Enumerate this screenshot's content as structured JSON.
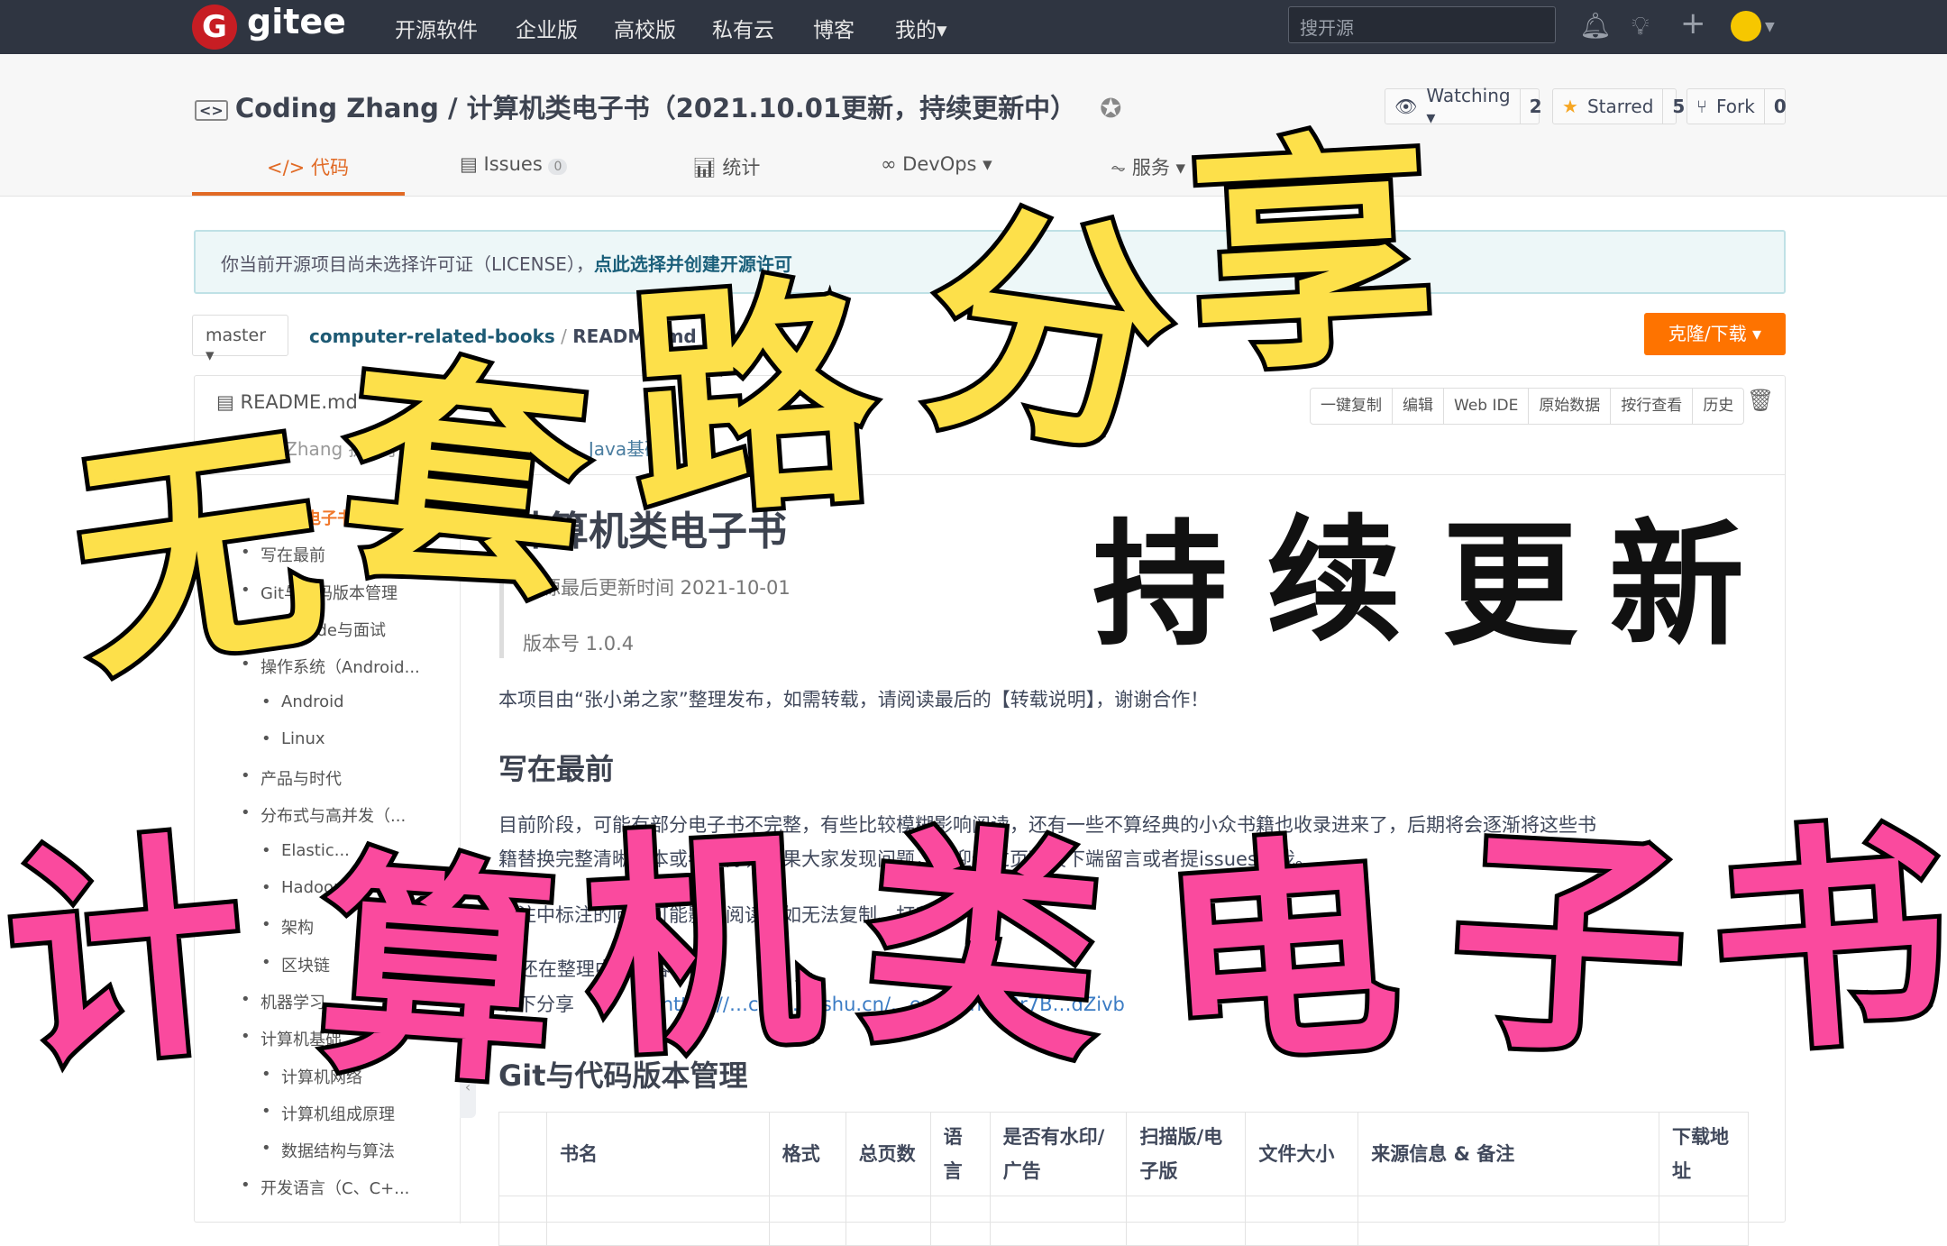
{
  "topbar": {
    "logo_letter": "G",
    "logo_text": "gitee",
    "nav": [
      "开源软件",
      "企业版",
      "高校版",
      "私有云",
      "博客",
      "我的▾"
    ],
    "search_placeholder": "搜开源",
    "icons": [
      "bell-icon",
      "bulb-icon",
      "plus-icon",
      "avatar"
    ]
  },
  "repo": {
    "title": "Coding Zhang / 计算机类电子书（2021.10.01更新，持续更新中）",
    "watch": {
      "label": "Watching ▾",
      "count": "2"
    },
    "star": {
      "label": "Starred",
      "count": "5"
    },
    "fork": {
      "label": "Fork",
      "count": "0"
    },
    "tabs": [
      {
        "label": "代码",
        "icon": "code-icon"
      },
      {
        "label": "Issues",
        "count": "0"
      },
      {
        "label": "统计"
      },
      {
        "label": "DevOps ▾"
      },
      {
        "label": "服务 ▾"
      }
    ]
  },
  "notice": {
    "text": "你当前开源项目尚未选择许可证（LICENSE），",
    "link": "点此选择并创建开源许可"
  },
  "branch": "master ▾",
  "breadcrumb": {
    "repo": "computer-related-books",
    "sep": " / ",
    "file": "README.md"
  },
  "clone_label": "克隆/下载 ▾",
  "readme": {
    "filename": "README.md",
    "commit_author": "Coding Zhang 提交于",
    "commit_msg": "Java基础",
    "toolbar": [
      "一键复制",
      "编辑",
      "Web IDE",
      "原始数据",
      "按行查看",
      "历史"
    ]
  },
  "toc": [
    {
      "label": "计算机类电子书",
      "level": 1,
      "current": true
    },
    {
      "label": "写在最前",
      "level": 2
    },
    {
      "label": "Git与代码版本管理",
      "level": 2
    },
    {
      "label": "LeetCode与面试",
      "level": 2
    },
    {
      "label": "操作系统（Android...",
      "level": 2
    },
    {
      "label": "Android",
      "level": 3
    },
    {
      "label": "Linux",
      "level": 3
    },
    {
      "label": "产品与时代",
      "level": 2
    },
    {
      "label": "分布式与高并发（...",
      "level": 2
    },
    {
      "label": "Elastic...",
      "level": 3
    },
    {
      "label": "Hadoop",
      "level": 3
    },
    {
      "label": "架构",
      "level": 3
    },
    {
      "label": "区块链",
      "level": 3
    },
    {
      "label": "机器学习",
      "level": 2
    },
    {
      "label": "计算机基础",
      "level": 2
    },
    {
      "label": "计算机网络",
      "level": 3
    },
    {
      "label": "计算机组成原理",
      "level": 3
    },
    {
      "label": "数据结构与算法",
      "level": 3
    },
    {
      "label": "开发语言（C、C+...",
      "level": 2
    }
  ],
  "content": {
    "h1": "计算机类电子书",
    "updated": "资源最后更新时间 2021-10-01",
    "version": "版本号 1.0.4",
    "intro": "本项目由“张小弟之家”整理发布，如需转载，请阅读最后的【转载说明】，谢谢合作！",
    "h2_first": "写在最前",
    "para1_line1": "目前阶段，可能有部分电子书不完整，有些比较模糊影响阅读，还有一些不算经典的小众书籍也收录进来了，后期将会逐渐将这些书",
    "para1_line2": "籍替换完整清晰版本或者删除，如果大家发现问题，欢迎通过页面最下端留言或者提issues给我。",
    "para2": "备注中标注的问题可能影响阅读，如无法复制、打印等。",
    "details": "▶ 还在整理中的内容",
    "share_prefix": "以下分享",
    "share_link": "https://…cxzti.feishu.cn/…er/fldcnHe3r7B…dZivb",
    "h2_git": "Git与代码版本管理",
    "table_headers": [
      "",
      "书名",
      "格式",
      "总页数",
      "语言",
      "是否有水印/广告",
      "扫描版/电子版",
      "文件大小",
      "来源信息 & 备注",
      "下载地址"
    ]
  },
  "overlay": {
    "yellow": "无套路分享",
    "black": "持续更新",
    "pink": "计算机类电子书"
  }
}
